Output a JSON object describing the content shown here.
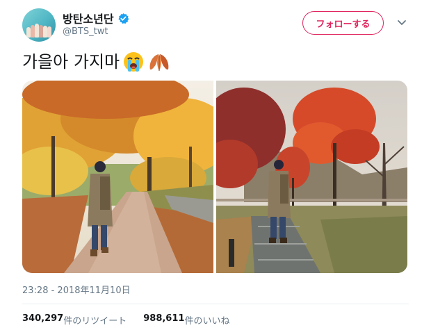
{
  "user": {
    "display_name": "방탄소년단",
    "handle": "@BTS_twt",
    "verified": true
  },
  "header": {
    "follow_label": "フォローする",
    "menu_icon": "chevron-down-icon"
  },
  "tweet": {
    "text": "가을아 가지마",
    "emojis": [
      "loudly-crying-face-icon",
      "fallen-leaf-icon"
    ]
  },
  "media": {
    "photos": [
      {
        "description_icon": "photo-autumn-path-yellow-trees"
      },
      {
        "description_icon": "photo-autumn-path-red-maples"
      }
    ]
  },
  "meta": {
    "timestamp": "23:28 - 2018年11月10日"
  },
  "stats": {
    "retweets_count": "340,297",
    "retweets_label": "件のリツイート",
    "likes_count": "988,611",
    "likes_label": "件のいいね"
  },
  "colors": {
    "accent": "#e0245e",
    "verified": "#1da1f2",
    "secondary_text": "#657786"
  }
}
